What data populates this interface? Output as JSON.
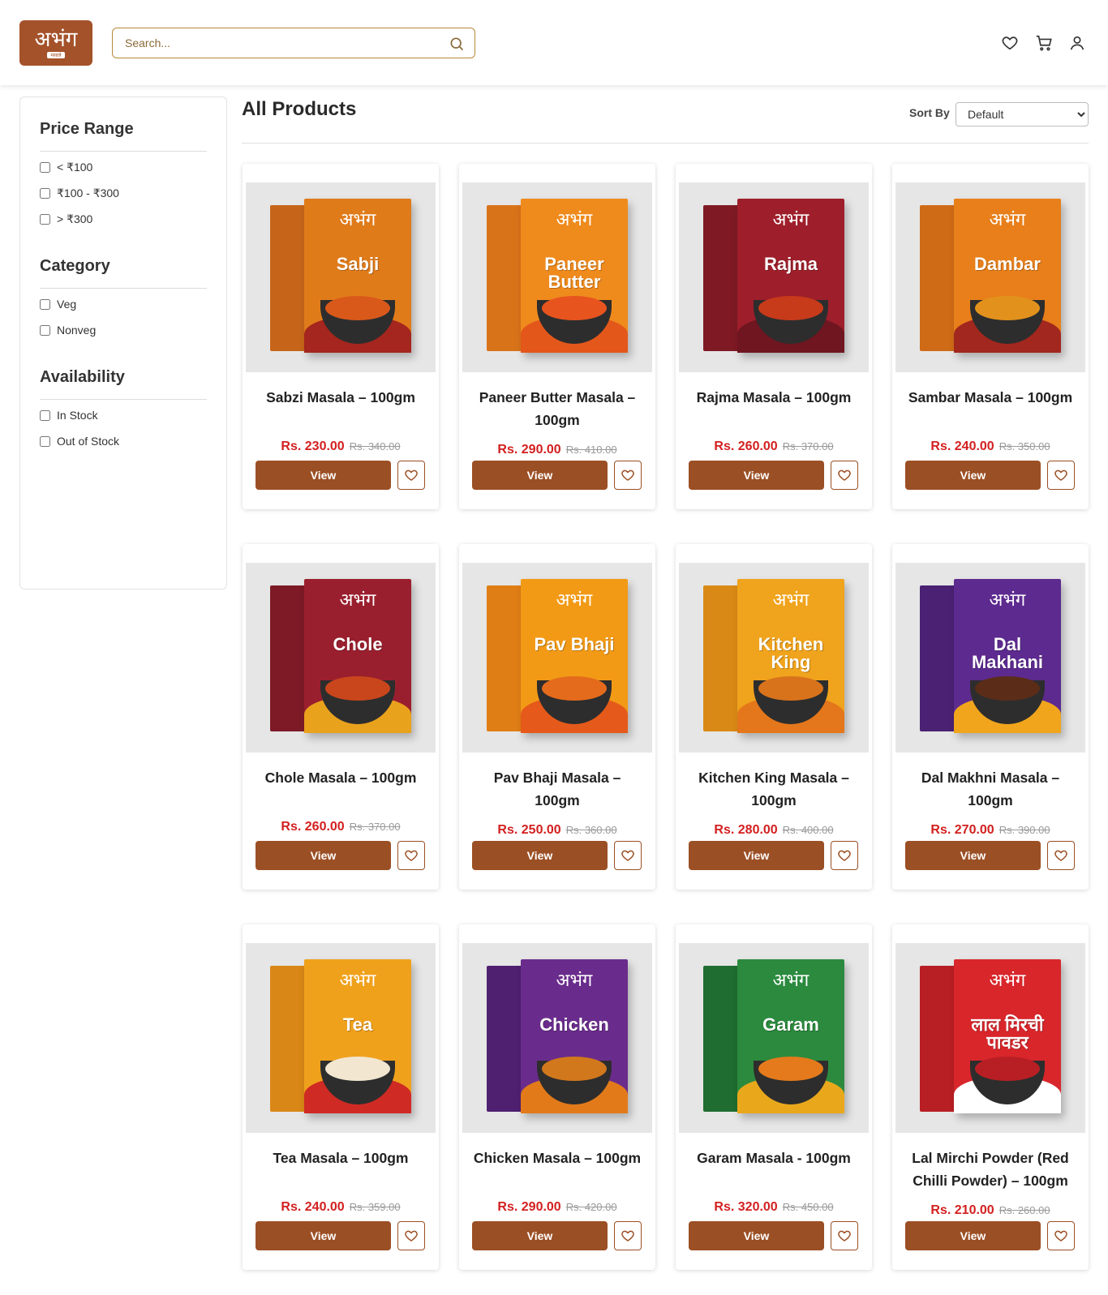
{
  "header": {
    "logo_text": "अभंग",
    "logo_subtext": "मसाले",
    "search_placeholder": "Search..."
  },
  "icons": {
    "search": "search-icon",
    "wishlist": "heart-icon",
    "cart": "cart-icon",
    "account": "user-icon"
  },
  "colors": {
    "brand": "#9b4f24",
    "price": "#d32020",
    "search_border": "#b88a3a"
  },
  "filters": {
    "price_title": "Price Range",
    "price_options": [
      "< ₹100",
      "₹100 - ₹300",
      "> ₹300"
    ],
    "category_title": "Category",
    "category_options": [
      "Veg",
      "Nonveg"
    ],
    "availability_title": "Availability",
    "availability_options": [
      "In Stock",
      "Out of Stock"
    ]
  },
  "main": {
    "title": "All Products",
    "sort_label": "Sort By",
    "sort_value": "Default"
  },
  "products": [
    {
      "name": "Sabzi Masala – 100gm",
      "price": "Rs. 230.00",
      "old_price": "Rs. 340.00",
      "view": "View",
      "box_label": "Sabji",
      "box_color": "#e07b1a",
      "box_back": "#c6651a",
      "wave": "#a4261e",
      "fill": "#d9591a"
    },
    {
      "name": "Paneer Butter Masala – 100gm",
      "price": "Rs. 290.00",
      "old_price": "Rs. 410.00",
      "view": "View",
      "box_label": "Paneer Butter",
      "box_color": "#ef8a1c",
      "box_back": "#d9731a",
      "wave": "#e3571b",
      "fill": "#e8541e"
    },
    {
      "name": "Rajma Masala – 100gm",
      "price": "Rs. 260.00",
      "old_price": "Rs. 370.00",
      "view": "View",
      "box_label": "Rajma",
      "box_color": "#9e1f2b",
      "box_back": "#7f1a24",
      "wave": "#6f1620",
      "fill": "#c73a1a"
    },
    {
      "name": "Sambar Masala – 100gm",
      "price": "Rs. 240.00",
      "old_price": "Rs. 350.00",
      "view": "View",
      "box_label": "Dambar",
      "box_color": "#e87f1a",
      "box_back": "#cf6b17",
      "wave": "#a2271e",
      "fill": "#e2921c"
    },
    {
      "name": "Chole Masala – 100gm",
      "price": "Rs. 260.00",
      "old_price": "Rs. 370.00",
      "view": "View",
      "box_label": "Chole",
      "box_color": "#9a1f2e",
      "box_back": "#7d1a26",
      "wave": "#e9a21c",
      "fill": "#c9461c"
    },
    {
      "name": "Pav Bhaji Masala – 100gm",
      "price": "Rs. 250.00",
      "old_price": "Rs. 360.00",
      "view": "View",
      "box_label": "Pav Bhaji",
      "box_color": "#f29a16",
      "box_back": "#e07e16",
      "wave": "#e55a1a",
      "fill": "#e56b1c"
    },
    {
      "name": "Kitchen King Masala – 100gm",
      "price": "Rs. 280.00",
      "old_price": "Rs. 400.00",
      "view": "View",
      "box_label": "Kitchen King",
      "box_color": "#f0a31c",
      "box_back": "#d98a16",
      "wave": "#e4761b",
      "fill": "#d8731c"
    },
    {
      "name": "Dal Makhni Masala – 100gm",
      "price": "Rs. 270.00",
      "old_price": "Rs. 390.00",
      "view": "View",
      "box_label": "Dal Makhani",
      "box_color": "#5d2a8f",
      "box_back": "#4a2173",
      "wave": "#f0a51c",
      "fill": "#5b2d18"
    },
    {
      "name": "Tea Masala – 100gm",
      "price": "Rs. 240.00",
      "old_price": "Rs. 359.00",
      "view": "View",
      "box_label": "Tea",
      "box_color": "#f0a11c",
      "box_back": "#d98716",
      "wave": "#cf2a24",
      "fill": "#f2e6d0"
    },
    {
      "name": "Chicken Masala – 100gm",
      "price": "Rs. 290.00",
      "old_price": "Rs. 420.00",
      "view": "View",
      "box_label": "Chicken",
      "box_color": "#6a2c8c",
      "box_back": "#4f2070",
      "wave": "#e27a1a",
      "fill": "#d1781c"
    },
    {
      "name": "Garam Masala - 100gm",
      "price": "Rs. 320.00",
      "old_price": "Rs. 450.00",
      "view": "View",
      "box_label": "Garam",
      "box_color": "#2b8a3e",
      "box_back": "#1f6d30",
      "wave": "#e9a81c",
      "fill": "#e47a1c"
    },
    {
      "name": "Lal Mirchi Powder (Red Chilli Powder) – 100gm",
      "price": "Rs. 210.00",
      "old_price": "Rs. 260.00",
      "view": "View",
      "box_label": "लाल मिरची पावडर",
      "box_color": "#d8262b",
      "box_back": "#b81f24",
      "wave": "#ffffff",
      "fill": "#b81f24"
    }
  ]
}
